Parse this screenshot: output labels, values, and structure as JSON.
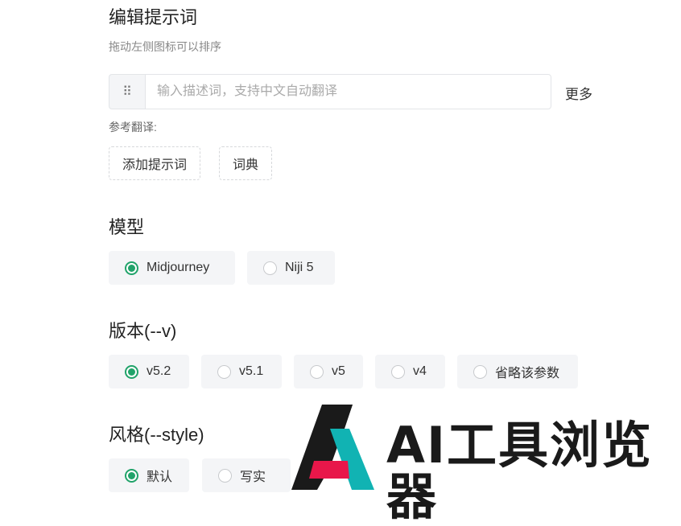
{
  "editor": {
    "title": "编辑提示词",
    "subtitle": "拖动左侧图标可以排序",
    "input_placeholder": "输入描述词，支持中文自动翻译",
    "more_label": "更多",
    "reference_label": "参考翻译:",
    "add_prompt_label": "添加提示词",
    "dictionary_label": "词典"
  },
  "model": {
    "title": "模型",
    "options": [
      {
        "label": "Midjourney",
        "selected": true
      },
      {
        "label": "Niji 5",
        "selected": false
      }
    ]
  },
  "version": {
    "title": "版本(--v)",
    "options": [
      {
        "label": "v5.2",
        "selected": true
      },
      {
        "label": "v5.1",
        "selected": false
      },
      {
        "label": "v5",
        "selected": false
      },
      {
        "label": "v4",
        "selected": false
      },
      {
        "label": "省略该参数",
        "selected": false
      }
    ]
  },
  "style": {
    "title": "风格(--style)",
    "options": [
      {
        "label": "默认",
        "selected": true
      },
      {
        "label": "写实",
        "selected": false
      }
    ]
  },
  "watermark": {
    "text": "AI工具浏览器",
    "colors": {
      "dark": "#1a1a1a",
      "teal": "#11b3b3",
      "red": "#e8174a"
    }
  },
  "accent_color": "#21a36a"
}
